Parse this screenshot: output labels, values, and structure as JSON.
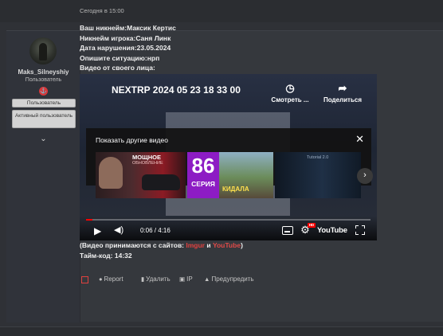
{
  "author": {
    "username": "Maks_Silneyshiy",
    "title": "Пользователь",
    "role_buttons": [
      "Пользователь",
      "Активный пользователь"
    ]
  },
  "post": {
    "date": "Сегодня в 15:00",
    "lines": [
      "Ваш никнейм:Максик Кертис",
      "Никнейм игрока:Саня Линк",
      "Дата нарушения:23.05.2024",
      "Опишите ситуацию:нрп",
      "Видео от своего лица:"
    ],
    "note_prefix": "(Видео принимаются с сайтов: ",
    "note_site1": "Imgur",
    "note_and": " и ",
    "note_site2": "YouTube",
    "note_suffix": ")",
    "timecode": "Тайм-код: 14:32"
  },
  "video": {
    "title": "NEXTRP 2024 05 23 18 33 00",
    "watch_later": "Смотреть ...",
    "share": "Поделиться",
    "more_videos_title": "Показать другие видео",
    "thumb1_text1": "МОЩНОЕ",
    "thumb1_text2": "ОБНОВЛЕНИЕ",
    "thumb2_number": "86",
    "thumb2_label": "СЕРИЯ",
    "thumb2_caption": "КИДАЛА",
    "thumb3_text": "Tutorial 2.0",
    "time": "0:06 / 4:16",
    "progress": 0.023,
    "hd_badge": "HD",
    "logo": "YouTube"
  },
  "actions": {
    "report": "Report",
    "delete": "Удалить",
    "ip": "IP",
    "warn": "Предупредить"
  },
  "colors": {
    "accent_red": "#e0413f",
    "youtube_red": "#ff0000"
  }
}
